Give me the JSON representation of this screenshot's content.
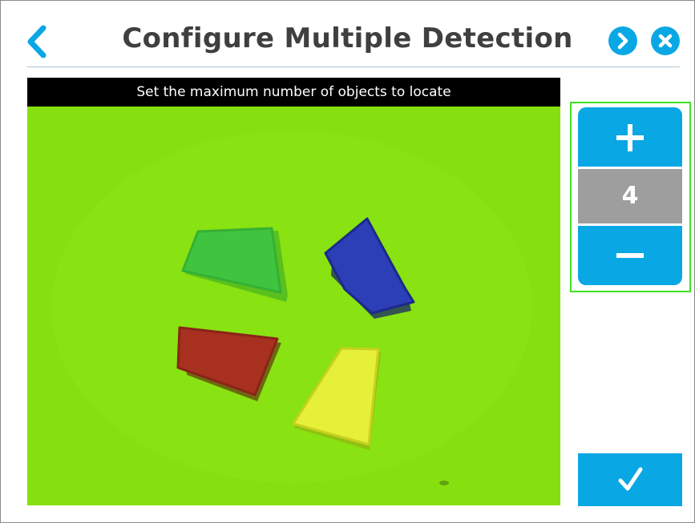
{
  "header": {
    "title": "Configure Multiple Detection",
    "back_icon": "chevron-left-icon",
    "play_icon": "play-icon",
    "close_icon": "close-icon"
  },
  "camera_view": {
    "instruction": "Set the maximum number of objects to locate",
    "background_color": "#86e00f",
    "objects": [
      "green-piece",
      "blue-piece",
      "red-piece",
      "yellow-piece"
    ]
  },
  "counter": {
    "increment_icon": "plus-icon",
    "value": "4",
    "decrement_icon": "minus-icon"
  },
  "confirm": {
    "icon": "checkmark-icon"
  },
  "colors": {
    "accent": "#0aa7e5",
    "highlight": "#3fe21f",
    "counter_bg": "#9e9e9e",
    "title": "#3f3f3f"
  }
}
